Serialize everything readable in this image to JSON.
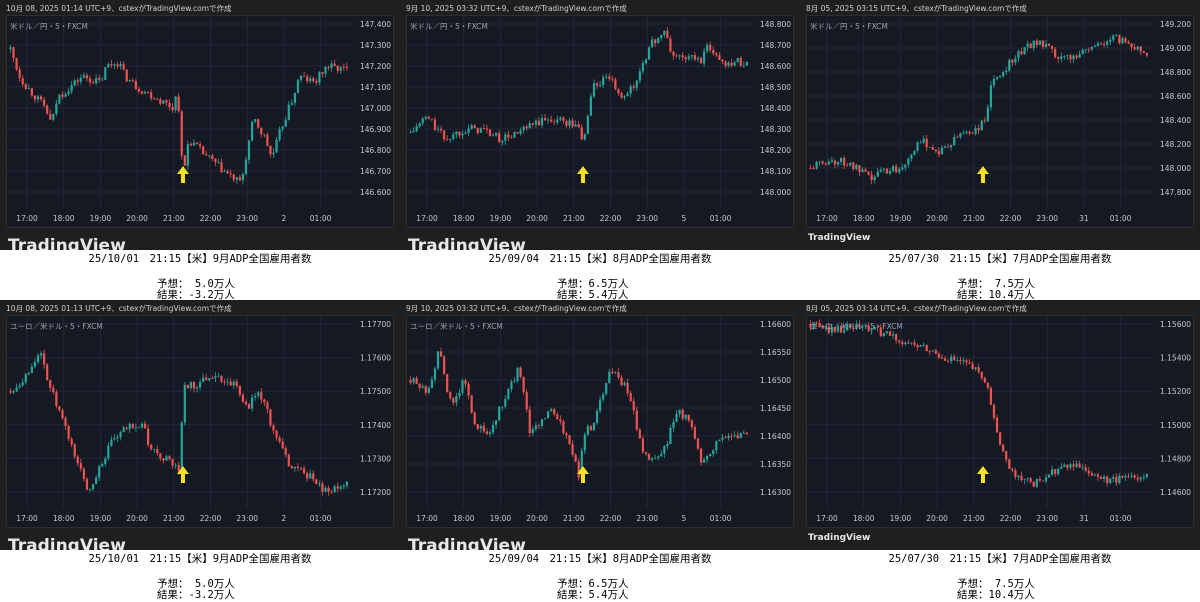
{
  "colors": {
    "up": "#26a69a",
    "down": "#ef5350",
    "arrow": "#f5e12a",
    "grid": "#232836"
  },
  "chart_data": [
    {
      "type": "candlestick",
      "header": "10月 08, 2025 01:14 UTC+9、cstexがTradingView.comで作成",
      "symbol": "米ドル／円・5・FXCM",
      "yticks": [
        "147.400",
        "147.300",
        "147.200",
        "147.100",
        "147.000",
        "146.900",
        "146.800",
        "146.700",
        "146.600"
      ],
      "ylim": [
        146.6,
        147.4
      ],
      "xticks": [
        "17:00",
        "18:00",
        "19:00",
        "20:00",
        "21:00",
        "22:00",
        "23:00",
        "2",
        "01:00"
      ],
      "event_hour": 21.25,
      "path": [
        [
          16.55,
          147.28
        ],
        [
          16.8,
          147.15
        ],
        [
          17,
          147.1
        ],
        [
          17.5,
          147.0
        ],
        [
          17.67,
          146.92
        ],
        [
          17.83,
          147.05
        ],
        [
          18.17,
          147.1
        ],
        [
          18.5,
          147.15
        ],
        [
          19,
          147.12
        ],
        [
          19.17,
          147.2
        ],
        [
          19.5,
          147.22
        ],
        [
          19.67,
          147.15
        ],
        [
          20,
          147.1
        ],
        [
          20.5,
          147.05
        ],
        [
          21,
          147.0
        ],
        [
          21.1,
          147.1
        ],
        [
          21.25,
          146.66
        ],
        [
          21.4,
          146.85
        ],
        [
          21.83,
          146.78
        ],
        [
          22.5,
          146.68
        ],
        [
          22.83,
          146.64
        ],
        [
          23.17,
          146.95
        ],
        [
          23.5,
          146.85
        ],
        [
          23.67,
          146.76
        ],
        [
          23.92,
          146.9
        ],
        [
          24.25,
          147.05
        ],
        [
          24.42,
          147.15
        ],
        [
          24.83,
          147.12
        ],
        [
          25.17,
          147.2
        ],
        [
          25.75,
          147.18
        ]
      ],
      "caption": {
        "title": "25/10/01　21:15【米】9月ADP全国雇用者数",
        "forecast": "予想： 5.0万人",
        "result": "結果：-3.2万人"
      },
      "logo": "TradingView",
      "logo_small": false
    },
    {
      "type": "candlestick",
      "header": "9月 10, 2025 03:32 UTC+9、cstexがTradingView.comで作成",
      "symbol": "米ドル／円・5・FXCM",
      "yticks": [
        "148.800",
        "148.700",
        "148.600",
        "148.500",
        "148.400",
        "148.300",
        "148.200",
        "148.100",
        "148.000"
      ],
      "ylim": [
        148.0,
        148.8
      ],
      "xticks": [
        "17:00",
        "18:00",
        "19:00",
        "20:00",
        "21:00",
        "22:00",
        "23:00",
        "5",
        "01:00"
      ],
      "event_hour": 21.25,
      "path": [
        [
          16.55,
          148.28
        ],
        [
          17,
          148.36
        ],
        [
          17.5,
          148.25
        ],
        [
          18,
          148.3
        ],
        [
          18.5,
          148.3
        ],
        [
          19,
          148.25
        ],
        [
          19.5,
          148.28
        ],
        [
          20,
          148.33
        ],
        [
          20.5,
          148.35
        ],
        [
          21,
          148.32
        ],
        [
          21.17,
          148.3
        ],
        [
          21.25,
          148.22
        ],
        [
          21.5,
          148.5
        ],
        [
          22,
          148.55
        ],
        [
          22.17,
          148.45
        ],
        [
          22.67,
          148.5
        ],
        [
          22.83,
          148.6
        ],
        [
          23.17,
          148.72
        ],
        [
          23.5,
          148.76
        ],
        [
          23.67,
          148.65
        ],
        [
          24.5,
          148.63
        ],
        [
          24.67,
          148.7
        ],
        [
          25,
          148.62
        ],
        [
          25.75,
          148.62
        ]
      ],
      "caption": {
        "title": "25/09/04　21:15【米】8月ADP全国雇用者数",
        "forecast": "予想：6.5万人",
        "result": "結果：5.4万人"
      },
      "logo": "TradingView",
      "logo_small": false
    },
    {
      "type": "candlestick",
      "header": "8月 05, 2025 03:15 UTC+9、cstexがTradingView.comで作成",
      "symbol": "米ドル／円・5・FXCM",
      "yticks": [
        "149.200",
        "149.000",
        "148.800",
        "148.600",
        "148.400",
        "148.200",
        "148.000",
        "147.800"
      ],
      "ylim": [
        147.8,
        149.2
      ],
      "xticks": [
        "17:00",
        "18:00",
        "19:00",
        "20:00",
        "21:00",
        "22:00",
        "23:00",
        "31",
        "01:00"
      ],
      "event_hour": 21.25,
      "path": [
        [
          16.55,
          148.0
        ],
        [
          17,
          148.06
        ],
        [
          17.5,
          148.05
        ],
        [
          18,
          147.95
        ],
        [
          18.17,
          147.9
        ],
        [
          18.5,
          147.98
        ],
        [
          19,
          148.0
        ],
        [
          19.33,
          148.15
        ],
        [
          19.67,
          148.22
        ],
        [
          20,
          148.13
        ],
        [
          20.33,
          148.18
        ],
        [
          20.67,
          148.3
        ],
        [
          21,
          148.3
        ],
        [
          21.17,
          148.35
        ],
        [
          21.33,
          148.4
        ],
        [
          21.45,
          148.68
        ],
        [
          21.67,
          148.75
        ],
        [
          22,
          148.9
        ],
        [
          22.33,
          148.98
        ],
        [
          22.67,
          149.06
        ],
        [
          23,
          149.0
        ],
        [
          23.33,
          148.9
        ],
        [
          23.67,
          148.93
        ],
        [
          24,
          148.98
        ],
        [
          24.33,
          149.02
        ],
        [
          24.83,
          149.08
        ],
        [
          25.17,
          149.05
        ],
        [
          25.75,
          148.95
        ]
      ],
      "caption": {
        "title": "25/07/30　21:15【米】7月ADP全国雇用者数",
        "forecast": "予想： 7.5万人",
        "result": "結果：10.4万人"
      },
      "logo": "TradingView",
      "logo_small": true
    },
    {
      "type": "candlestick",
      "header": "10月 08, 2025 01:13 UTC+9、cstexがTradingView.comで作成",
      "symbol": "ユーロ／米ドル・5・FXCM",
      "yticks": [
        "1.17700",
        "1.17600",
        "1.17500",
        "1.17400",
        "1.17300",
        "1.17200"
      ],
      "ylim": [
        1.172,
        1.177
      ],
      "xticks": [
        "17:00",
        "18:00",
        "19:00",
        "20:00",
        "21:00",
        "22:00",
        "23:00",
        "2",
        "01:00"
      ],
      "event_hour": 21.25,
      "path": [
        [
          16.55,
          1.175
        ],
        [
          17,
          1.1755
        ],
        [
          17.33,
          1.1762
        ],
        [
          17.67,
          1.175
        ],
        [
          18.17,
          1.1735
        ],
        [
          18.67,
          1.172
        ],
        [
          19,
          1.1728
        ],
        [
          19.33,
          1.1735
        ],
        [
          19.83,
          1.174
        ],
        [
          20.17,
          1.174
        ],
        [
          20.33,
          1.1733
        ],
        [
          21,
          1.1728
        ],
        [
          21.17,
          1.1725
        ],
        [
          21.25,
          1.1752
        ],
        [
          21.67,
          1.1752
        ],
        [
          22,
          1.1755
        ],
        [
          22.67,
          1.1752
        ],
        [
          23,
          1.1745
        ],
        [
          23.33,
          1.175
        ],
        [
          23.83,
          1.1735
        ],
        [
          24.17,
          1.1728
        ],
        [
          24.67,
          1.1725
        ],
        [
          25.17,
          1.172
        ],
        [
          25.75,
          1.1722
        ]
      ],
      "caption": {
        "title": "25/10/01　21:15【米】9月ADP全国雇用者数",
        "forecast": "予想： 5.0万人",
        "result": "結果：-3.2万人"
      },
      "logo": "TradingView",
      "logo_small": false
    },
    {
      "type": "candlestick",
      "header": "9月 10, 2025 03:32 UTC+9、cstexがTradingView.comで作成",
      "symbol": "ユーロ／米ドル・5・FXCM",
      "yticks": [
        "1.16600",
        "1.16550",
        "1.16500",
        "1.16450",
        "1.16400",
        "1.16350",
        "1.16300"
      ],
      "ylim": [
        1.163,
        1.166
      ],
      "xticks": [
        "17:00",
        "18:00",
        "19:00",
        "20:00",
        "21:00",
        "22:00",
        "23:00",
        "5",
        "01:00"
      ],
      "event_hour": 21.25,
      "path": [
        [
          16.55,
          1.165
        ],
        [
          17,
          1.1648
        ],
        [
          17.33,
          1.1655
        ],
        [
          17.67,
          1.1645
        ],
        [
          18,
          1.165
        ],
        [
          18.33,
          1.1642
        ],
        [
          18.67,
          1.164
        ],
        [
          19,
          1.1645
        ],
        [
          19.5,
          1.1652
        ],
        [
          19.83,
          1.164
        ],
        [
          20.33,
          1.1645
        ],
        [
          20.83,
          1.164
        ],
        [
          21.17,
          1.1632
        ],
        [
          21.25,
          1.164
        ],
        [
          21.5,
          1.1642
        ],
        [
          21.67,
          1.1645
        ],
        [
          22,
          1.1652
        ],
        [
          22.5,
          1.1648
        ],
        [
          22.83,
          1.1638
        ],
        [
          23.17,
          1.1635
        ],
        [
          23.5,
          1.1638
        ],
        [
          23.83,
          1.1645
        ],
        [
          24.17,
          1.1642
        ],
        [
          24.5,
          1.1635
        ],
        [
          25,
          1.164
        ],
        [
          25.75,
          1.164
        ]
      ],
      "caption": {
        "title": "25/09/04　21:15【米】8月ADP全国雇用者数",
        "forecast": "予想：6.5万人",
        "result": "結果：5.4万人"
      },
      "logo": "TradingView",
      "logo_small": false
    },
    {
      "type": "candlestick",
      "header": "8月 05, 2025 03:14 UTC+9、cstexがTradingView.comで作成",
      "symbol": "ユーロ／米ドル・5・FXCM",
      "yticks": [
        "1.15600",
        "1.15400",
        "1.15200",
        "1.15000",
        "1.14800",
        "1.14600"
      ],
      "ylim": [
        1.146,
        1.156
      ],
      "xticks": [
        "17:00",
        "18:00",
        "19:00",
        "20:00",
        "21:00",
        "22:00",
        "23:00",
        "31",
        "01:00"
      ],
      "event_hour": 21.25,
      "path": [
        [
          16.55,
          1.156
        ],
        [
          17,
          1.1557
        ],
        [
          18,
          1.1558
        ],
        [
          18.5,
          1.1555
        ],
        [
          19,
          1.155
        ],
        [
          19.67,
          1.1545
        ],
        [
          20.17,
          1.154
        ],
        [
          20.67,
          1.1537
        ],
        [
          21,
          1.1533
        ],
        [
          21.33,
          1.1525
        ],
        [
          21.5,
          1.151
        ],
        [
          21.83,
          1.148
        ],
        [
          22.17,
          1.147
        ],
        [
          22.67,
          1.1465
        ],
        [
          23,
          1.147
        ],
        [
          23.5,
          1.1475
        ],
        [
          24,
          1.1476
        ],
        [
          24.17,
          1.147
        ],
        [
          24.5,
          1.1467
        ],
        [
          25,
          1.1468
        ],
        [
          25.75,
          1.1471
        ]
      ],
      "caption": {
        "title": "25/07/30　21:15【米】7月ADP全国雇用者数",
        "forecast": "予想： 7.5万人",
        "result": "結果：10.4万人"
      },
      "logo": "TradingView",
      "logo_small": true
    }
  ]
}
